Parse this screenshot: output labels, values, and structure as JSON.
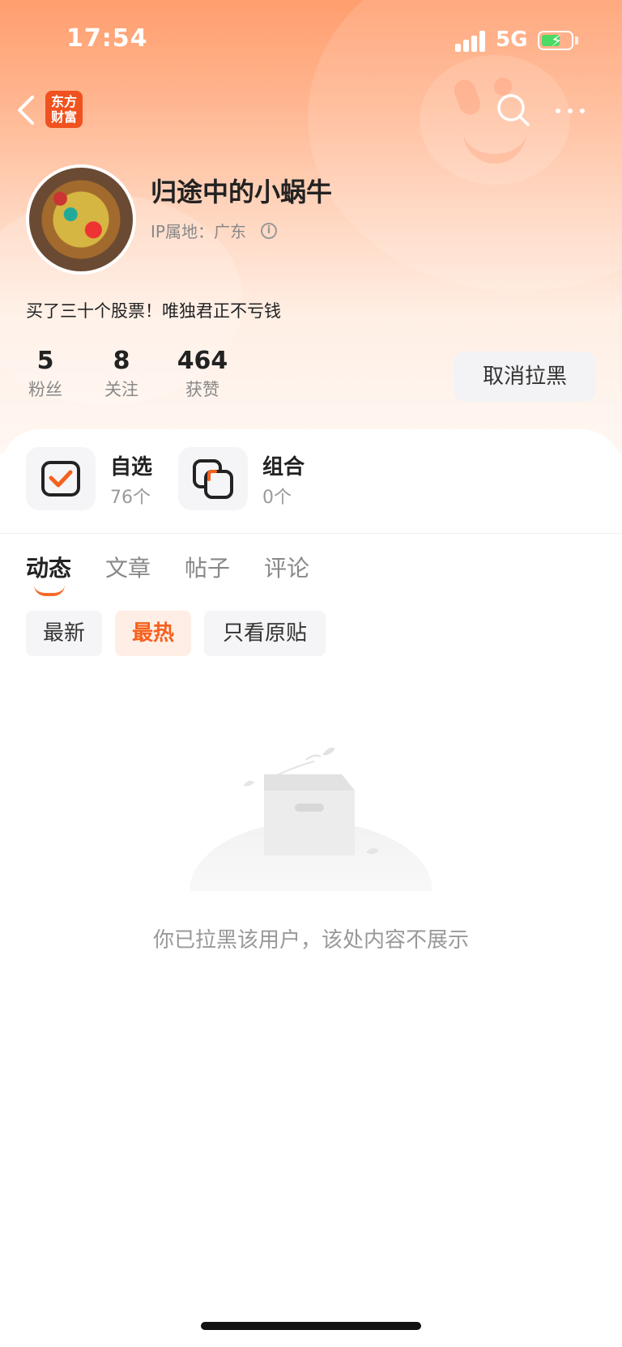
{
  "status_bar": {
    "time": "17:54",
    "network": "5G"
  },
  "nav": {
    "logo_text_line1": "东方",
    "logo_text_line2": "财富"
  },
  "profile": {
    "username": "归途中的小蜗牛",
    "ip_location": "IP属地：广东",
    "bio": "买了三十个股票！唯独君正不亏钱"
  },
  "stats": [
    {
      "value": "5",
      "label": "粉丝"
    },
    {
      "value": "8",
      "label": "关注"
    },
    {
      "value": "464",
      "label": "获赞"
    }
  ],
  "unblock_button": "取消拉黑",
  "quick_links": [
    {
      "title": "自选",
      "count": "76个"
    },
    {
      "title": "组合",
      "count": "0个"
    }
  ],
  "tabs": [
    "动态",
    "文章",
    "帖子",
    "评论"
  ],
  "active_tab": "动态",
  "filters": [
    "最新",
    "最热",
    "只看原贴"
  ],
  "active_filter": "最热",
  "empty_message": "你已拉黑该用户，该处内容不展示",
  "colors": {
    "accent": "#f5611e",
    "logo_bg": "#f0521f",
    "header_top": "#ff9e6e"
  }
}
